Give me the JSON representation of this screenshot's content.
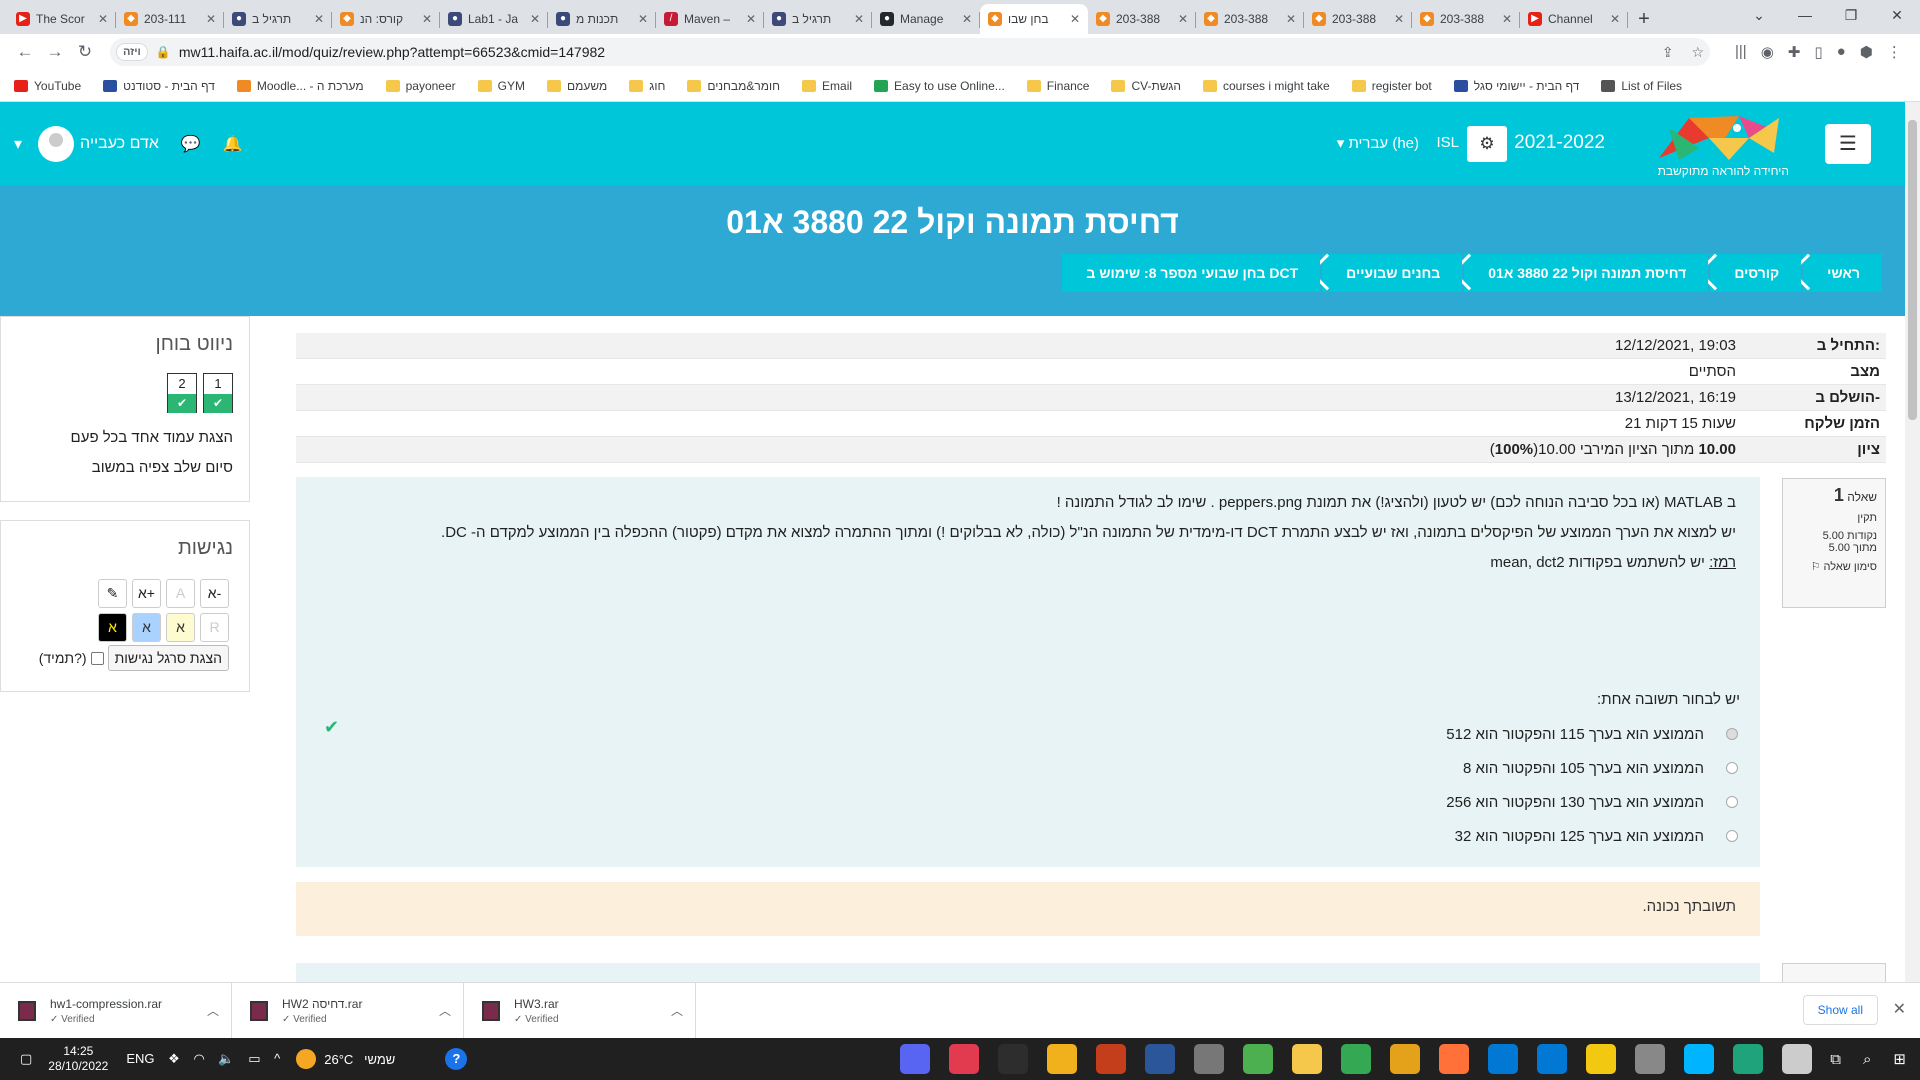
{
  "browser": {
    "tabs": [
      {
        "title": "The Scor",
        "color": "#e62117",
        "glyph": "▶"
      },
      {
        "title": "203-111",
        "color": "#f08a24",
        "glyph": "◆"
      },
      {
        "title": "תרגיל ב",
        "color": "#3c4a7a",
        "glyph": "●"
      },
      {
        "title": "קורס: הנ",
        "color": "#f08a24",
        "glyph": "◆"
      },
      {
        "title": "Lab1 - Ja",
        "color": "#3c4a7a",
        "glyph": "●"
      },
      {
        "title": "תכנות מ",
        "color": "#3c4a7a",
        "glyph": "●"
      },
      {
        "title": "Maven –",
        "color": "#c71a36",
        "glyph": "/"
      },
      {
        "title": "תרגיל ב",
        "color": "#3c4a7a",
        "glyph": "●"
      },
      {
        "title": "Manage",
        "color": "#24292e",
        "glyph": "●"
      },
      {
        "title": "בחן שבו",
        "color": "#f08a24",
        "glyph": "◆"
      },
      {
        "title": "203-388",
        "color": "#f08a24",
        "glyph": "◆"
      },
      {
        "title": "203-388",
        "color": "#f08a24",
        "glyph": "◆"
      },
      {
        "title": "203-388",
        "color": "#f08a24",
        "glyph": "◆"
      },
      {
        "title": "203-388",
        "color": "#f08a24",
        "glyph": "◆"
      },
      {
        "title": "Channel",
        "color": "#e62117",
        "glyph": "▶"
      }
    ],
    "active_tab_index": 9,
    "url": "mw11.haifa.ac.il/mod/quiz/review.php?attempt=66523&cmid=147982",
    "site_badge": "ויזה",
    "bookmarks": [
      {
        "label": "YouTube",
        "color": "#e62117"
      },
      {
        "label": "דף הבית - סטודנט",
        "color": "#2a4fa0"
      },
      {
        "label": "Moodle... - מערכת ה",
        "color": "#f08a24"
      },
      {
        "label": "payoneer",
        "color": "#f5c84c"
      },
      {
        "label": "GYM",
        "color": "#f5c84c"
      },
      {
        "label": "משעמם",
        "color": "#f5c84c"
      },
      {
        "label": "חוג",
        "color": "#f5c84c"
      },
      {
        "label": "חומר&מבחנים",
        "color": "#f5c84c"
      },
      {
        "label": "Email",
        "color": "#f5c84c"
      },
      {
        "label": "Easy to use Online...",
        "color": "#23a455"
      },
      {
        "label": "Finance",
        "color": "#f5c84c"
      },
      {
        "label": "CV-הגשת",
        "color": "#f5c84c"
      },
      {
        "label": "courses i might take",
        "color": "#f5c84c"
      },
      {
        "label": "register bot",
        "color": "#f5c84c"
      },
      {
        "label": "דף הבית - יישומי סגל",
        "color": "#2a4fa0"
      },
      {
        "label": "List of Files",
        "color": "#555555"
      }
    ]
  },
  "header": {
    "user_name": "אדם כעבייה",
    "language": "עברית (he)",
    "isl": "ISL",
    "year": "2021-2022",
    "logo_text": "היחידה להוראה מתוקשבת"
  },
  "page": {
    "title": "דחיסת תמונה וקול 22 3880 א01",
    "breadcrumbs": [
      "ראשי",
      "קורסים",
      "דחיסת תמונה וקול 22 3880 א01",
      "בחנים שבועיים",
      "בחן שבועי מספר 8: שימוש ב DCT"
    ]
  },
  "quiz_nav": {
    "title": "ניווט בוחן",
    "questions": [
      {
        "number": "1",
        "status": "✔"
      },
      {
        "number": "2",
        "status": "✔"
      }
    ],
    "show_one_page": "הצגת עמוד אחד בכל פעם",
    "finish_review": "סיום שלב צפיה במשוב"
  },
  "accessibility": {
    "title": "נגישות",
    "row1": [
      "א-",
      "A",
      "א+",
      "✎"
    ],
    "row2": [
      "R",
      "א",
      "א",
      "א"
    ],
    "toolbar_button": "הצגת סרגל נגישות",
    "always_label": "(תמיד?)"
  },
  "summary": [
    {
      "label": "התחיל ב:",
      "value": "12/12/2021, 19:03"
    },
    {
      "label": "מצב",
      "value": "הסתיים"
    },
    {
      "label": "הושלם ב-",
      "value": "13/12/2021, 16:19"
    },
    {
      "label": "הזמן שלקח",
      "value": "21 שעות 15 דקות"
    },
    {
      "label": "ציון",
      "value_bold": "10.00",
      "value_rest": "מתוך הציון המירבי 10.00(",
      "value_pct": "100%",
      "value_end": ")"
    }
  ],
  "question1": {
    "label": "שאלה",
    "number": "1",
    "status": "תקין",
    "points": "5.00 נקודות",
    "out_of": "מתוך 5.00",
    "flag": "סימון שאלה",
    "text1": "ב MATLAB (או בכל סביבה הנוחה לכם) יש לטעון (ולהציג!) את תמונת  peppers.png  . שימו לב לגודל התמונה !",
    "text2": "יש למצוא את הערך הממוצע של הפיקסלים בתמונה, ואז יש לבצע התמרת DCT דו-מימדית של התמונה הנ\"ל (כולה, לא בבלוקים !) ומתוך ההתמרה למצוא את מקדם (פקטור) ההכפלה בין הממוצע למקדם ה- DC.",
    "hint_label": "רמז:",
    "hint_text": " יש להשתמש בפקודות mean, dct2",
    "prompt": "יש לבחור תשובה אחת:",
    "options": [
      "הממוצע הוא בערך 115 והפקטור הוא  512",
      "הממוצע הוא בערך 105 והפקטור הוא  8",
      "הממוצע הוא בערך 130 והפקטור הוא  256",
      "הממוצע הוא בערך 125 והפקטור הוא  32"
    ],
    "selected_index": 0,
    "feedback": "תשובתך נכונה."
  },
  "downloads": {
    "items": [
      {
        "name": "hw1-compression.rar",
        "status": "✓ Verified"
      },
      {
        "name": "HW2 דחיסה.rar",
        "status": "✓ Verified"
      },
      {
        "name": "HW3.rar",
        "status": "✓ Verified"
      }
    ],
    "show_all": "Show all"
  },
  "taskbar": {
    "time": "14:25",
    "date": "28/10/2022",
    "lang": "ENG",
    "temperature": "26°C",
    "weather_label": "שמשי",
    "app_colors": [
      "#5865f2",
      "#e23b4f",
      "#2d2d2d",
      "#f1b11c",
      "#c43e1c",
      "#2b579a",
      "#777777",
      "#4caf50",
      "#f5c84c",
      "#34a853",
      "#e3a21a",
      "#ff7139",
      "#0078d4",
      "#0078d4",
      "#f2c811",
      "#888888",
      "#00b4ff",
      "#1fa37b",
      "#cccccc"
    ]
  }
}
